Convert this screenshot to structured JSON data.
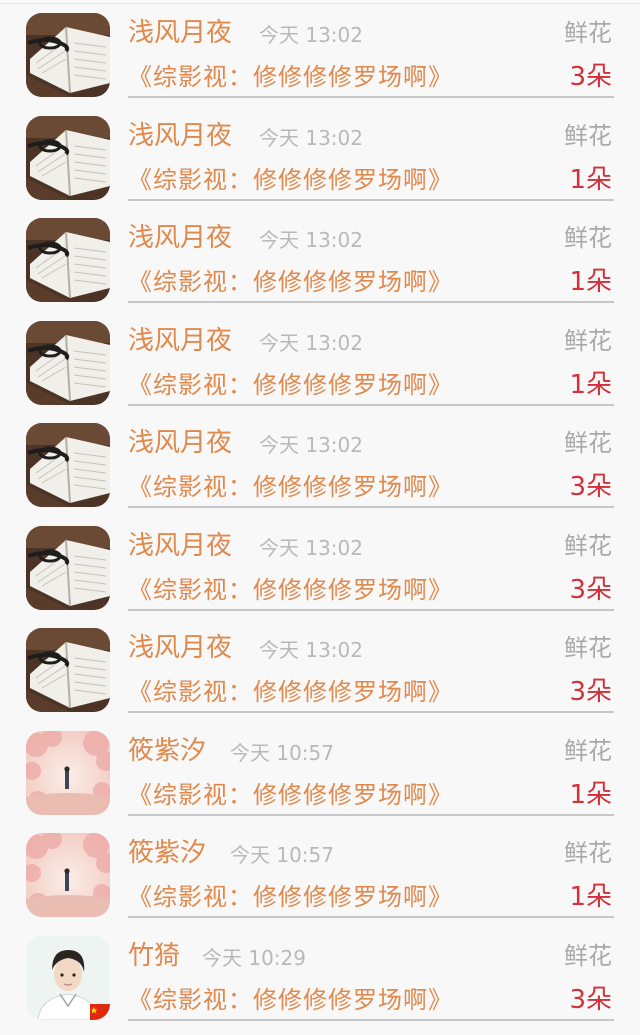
{
  "rows": [
    {
      "avatar": "book-avatar",
      "name": "浅风月夜",
      "time": "今天 13:02",
      "gift": "鲜花",
      "book": "《综影视：修修修修罗场啊》",
      "count": "3朵"
    },
    {
      "avatar": "book-avatar",
      "name": "浅风月夜",
      "time": "今天 13:02",
      "gift": "鲜花",
      "book": "《综影视：修修修修罗场啊》",
      "count": "1朵"
    },
    {
      "avatar": "book-avatar",
      "name": "浅风月夜",
      "time": "今天 13:02",
      "gift": "鲜花",
      "book": "《综影视：修修修修罗场啊》",
      "count": "1朵"
    },
    {
      "avatar": "book-avatar",
      "name": "浅风月夜",
      "time": "今天 13:02",
      "gift": "鲜花",
      "book": "《综影视：修修修修罗场啊》",
      "count": "1朵"
    },
    {
      "avatar": "book-avatar",
      "name": "浅风月夜",
      "time": "今天 13:02",
      "gift": "鲜花",
      "book": "《综影视：修修修修罗场啊》",
      "count": "3朵"
    },
    {
      "avatar": "book-avatar",
      "name": "浅风月夜",
      "time": "今天 13:02",
      "gift": "鲜花",
      "book": "《综影视：修修修修罗场啊》",
      "count": "3朵"
    },
    {
      "avatar": "book-avatar",
      "name": "浅风月夜",
      "time": "今天 13:02",
      "gift": "鲜花",
      "book": "《综影视：修修修修罗场啊》",
      "count": "3朵"
    },
    {
      "avatar": "blossom-avatar",
      "name": "筱紫汐",
      "time": "今天 10:57",
      "gift": "鲜花",
      "book": "《综影视：修修修修罗场啊》",
      "count": "1朵"
    },
    {
      "avatar": "blossom-avatar",
      "name": "筱紫汐",
      "time": "今天 10:57",
      "gift": "鲜花",
      "book": "《综影视：修修修修罗场啊》",
      "count": "1朵"
    },
    {
      "avatar": "person-avatar",
      "name": "竹猗",
      "time": "今天 10:29",
      "gift": "鲜花",
      "book": "《综影视：修修修修罗场啊》",
      "count": "3朵"
    }
  ],
  "colors": {
    "name": "#e0894c",
    "book": "#e0894c",
    "time": "#b9b9b9",
    "gift": "#a9a9a9",
    "count": "#d2303a",
    "divider": "#c7c7c9"
  }
}
